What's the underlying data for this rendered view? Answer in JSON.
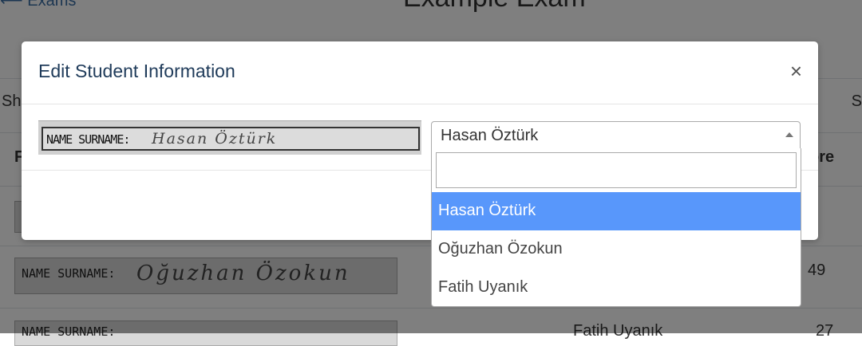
{
  "background": {
    "back_link": "⟵ Exams",
    "exam_title": "Example Exam",
    "edge_left": "Sh",
    "edge_right": "S",
    "header_left": "F",
    "header_right": "ore",
    "rows": [
      {
        "crop_label": "NAME SURNAME:",
        "crop_hand": "Oğuzhan Özokun",
        "score": "49"
      },
      {
        "crop_label": "NAME SURNAME:",
        "crop_hand": "",
        "name": "Fatih Uyanık",
        "score": "27"
      }
    ]
  },
  "modal": {
    "title": "Edit Student Information",
    "close": "×",
    "crop_label": "NAME SURNAME:",
    "crop_hand": "Hasan Öztürk",
    "select": {
      "value": "Hasan Öztürk",
      "search_value": "",
      "options": [
        "Hasan Öztürk",
        "Oğuzhan Özokun",
        "Fatih Uyanık"
      ],
      "highlighted_index": 0
    }
  },
  "colors": {
    "highlight": "#5897fb",
    "title": "#1f3b5a"
  }
}
